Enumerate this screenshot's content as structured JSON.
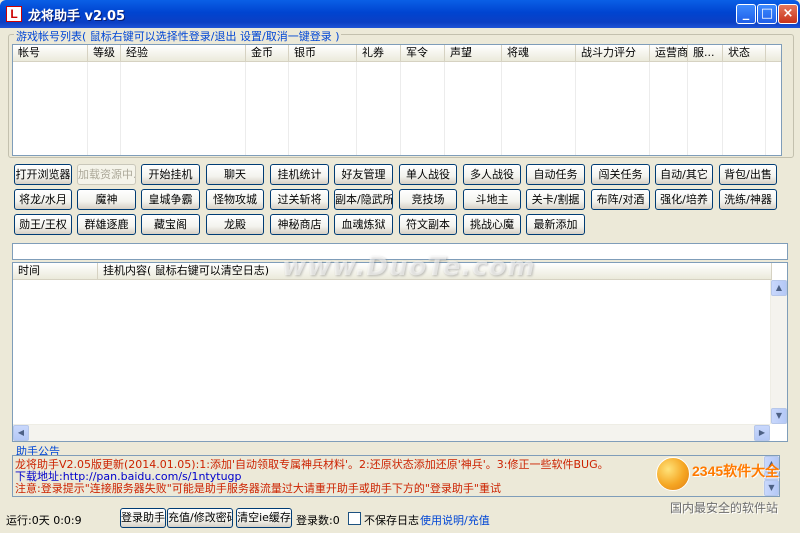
{
  "window": {
    "title": "龙将助手  v2.05",
    "controls": [
      "_",
      "□",
      "×"
    ]
  },
  "accounts": {
    "group_label": "游戏帐号列表( 鼠标右键可以选择性登录/退出 设置/取消一键登录 )",
    "columns": [
      "帐号",
      "等级",
      "经验",
      "金币",
      "银币",
      "礼券",
      "军令",
      "声望",
      "将魂",
      "战斗力评分",
      "运营商",
      "服...",
      "状态"
    ]
  },
  "buttons": {
    "row1": [
      "打开浏览器",
      "加载资源中...",
      "开始挂机",
      "聊天",
      "挂机统计",
      "好友管理",
      "单人战役",
      "多人战役",
      "自动任务",
      "闯关任务",
      "自动/其它",
      "背包/出售"
    ],
    "row2": [
      "将龙/水月",
      "魔神",
      "皇城争霸",
      "怪物攻城",
      "过关斩将",
      "副本/隐武所",
      "竞技场",
      "斗地主",
      "关卡/割据",
      "布阵/对酒",
      "强化/培养",
      "洗练/神器"
    ],
    "row3": [
      "勋王/王权",
      "群雄逐鹿",
      "藏宝阁",
      "龙殿",
      "神秘商店",
      "血魂炼狱",
      "符文副本",
      "挑战心魔",
      "最新添加"
    ]
  },
  "log": {
    "columns": [
      "时间",
      "挂机内容( 鼠标右键可以清空日志)"
    ]
  },
  "announcement": {
    "label": "助手公告",
    "line1": "龙将助手V2.05版更新(2014.01.05):1:添加'自动领取专属神兵材料'。2:还原状态添加还原'神兵'。3:修正一些软件BUG。",
    "line2": "下载地址:http://pan.baidu.com/s/1ntytugp",
    "line3": "注意:登录提示\"连接服务器失败\"可能是助手服务器流量过大请重开助手或助手下方的\"登录助手\"重试",
    "line1_color": "#cc2200",
    "line2_color": "#0000cc",
    "line3_color": "#cc2200"
  },
  "statusbar": {
    "runtime": "运行:0天 0:0:9",
    "login_button": "登录助手",
    "recharge_button": "充值/修改密码",
    "clear_cache_button": "清空ie缓存",
    "login_count": "登录数:0",
    "no_save_log": "不保存日志",
    "help_link": "使用说明/充值"
  },
  "watermarks": {
    "duote": "www.DuoTe.com",
    "brand_2345": "2345软件大全",
    "slogan_2345": "国内最安全的软件站"
  },
  "colors": {
    "accent": "#0046d5",
    "title_bar": "#0044d0",
    "window_bg": "#ece9d8"
  }
}
